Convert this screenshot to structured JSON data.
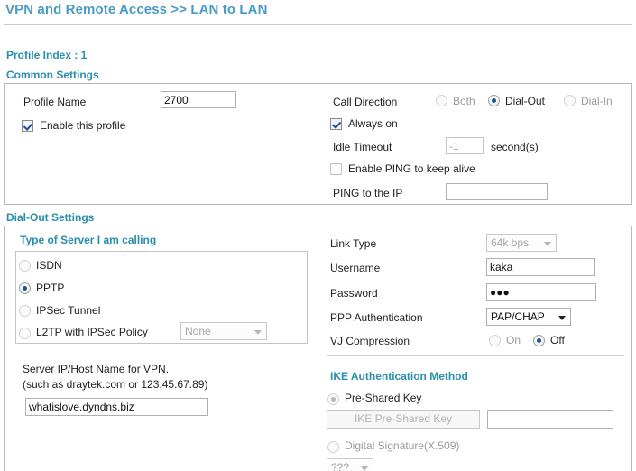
{
  "header": {
    "title": "VPN and Remote Access >> LAN to LAN"
  },
  "profile": {
    "index_label": "Profile Index : 1",
    "common_settings_label": "Common Settings"
  },
  "common": {
    "left": {
      "profile_name_label": "Profile Name",
      "profile_name_value": "2700",
      "enable_profile_label": "Enable this profile",
      "enable_profile_checked": true
    },
    "right": {
      "call_direction_label": "Call Direction",
      "call_direction_options": [
        "Both",
        "Dial-Out",
        "Dial-In"
      ],
      "call_direction_selected": "Dial-Out",
      "always_on_label": "Always on",
      "always_on_checked": true,
      "idle_timeout_label": "Idle Timeout",
      "idle_timeout_value": "-1",
      "idle_timeout_unit": "second(s)",
      "enable_ping_label": "Enable PING to keep alive",
      "enable_ping_checked": false,
      "ping_ip_label": "PING to the IP",
      "ping_ip_value": ""
    }
  },
  "dialout": {
    "section_label": "Dial-Out Settings",
    "left": {
      "server_type_heading": "Type of Server I am calling",
      "options": [
        {
          "label": "ISDN",
          "selected": false,
          "disabled": true
        },
        {
          "label": "PPTP",
          "selected": true,
          "disabled": false
        },
        {
          "label": "IPSec Tunnel",
          "selected": false,
          "disabled": true
        },
        {
          "label": "L2TP with IPSec Policy",
          "selected": false,
          "disabled": true
        }
      ],
      "l2tp_policy_value": "None",
      "server_ip_label_line1": "Server IP/Host Name for VPN.",
      "server_ip_label_line2": "(such as draytek.com or 123.45.67.89)",
      "server_ip_value": "whatislove.dyndns.biz"
    },
    "right": {
      "link_type_label": "Link Type",
      "link_type_value": "64k bps",
      "username_label": "Username",
      "username_value": "kaka",
      "password_label": "Password",
      "password_value": "●●●",
      "ppp_auth_label": "PPP Authentication",
      "ppp_auth_value": "PAP/CHAP",
      "vj_compression_label": "VJ Compression",
      "vj_options": [
        "On",
        "Off"
      ],
      "vj_selected": "Off",
      "ike_heading": "IKE Authentication Method",
      "pre_shared_key_label": "Pre-Shared Key",
      "pre_shared_key_selected": true,
      "ike_psk_button_label": "IKE Pre-Shared Key",
      "ike_psk_value": "",
      "digital_signature_label": "Digital Signature(X.509)",
      "digital_signature_selected": false,
      "cert_select_value": "???"
    }
  },
  "colors": {
    "title_blue": "#4a9bc4",
    "heading_teal": "#2a8fae",
    "radio_dot": "#14569e",
    "border_gray": "#b9b9b9"
  }
}
